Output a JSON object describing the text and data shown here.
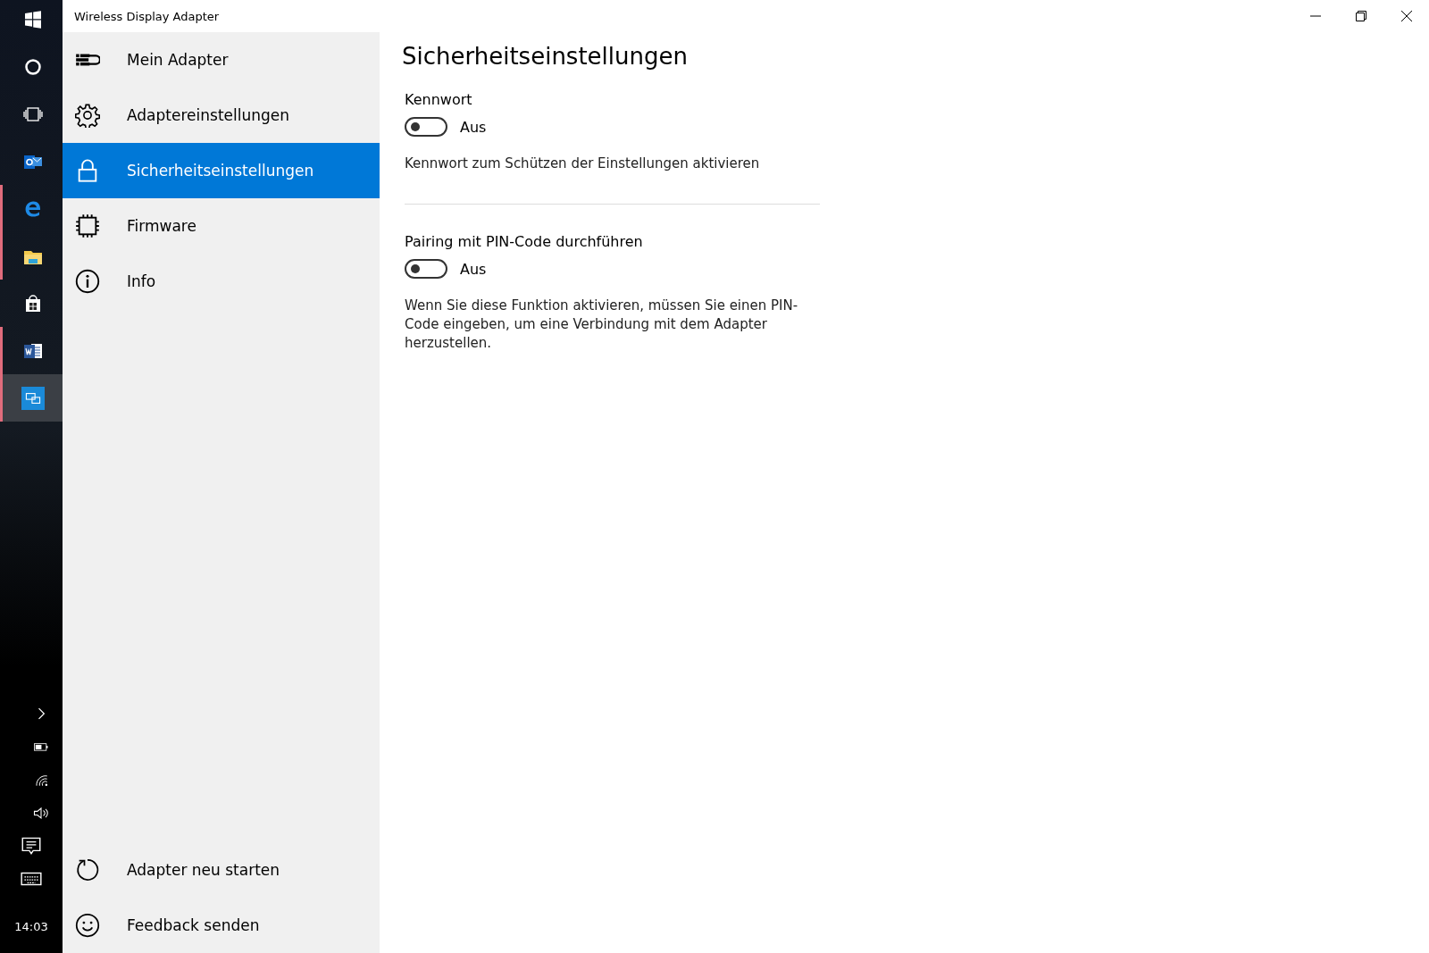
{
  "taskbar": {
    "apps": [
      {
        "kind": "start",
        "running": false,
        "selected": false
      },
      {
        "kind": "search",
        "running": false,
        "selected": false
      },
      {
        "kind": "taskview",
        "running": false,
        "selected": false
      },
      {
        "kind": "mail",
        "running": false,
        "selected": false
      },
      {
        "kind": "browser",
        "running": true,
        "selected": false
      },
      {
        "kind": "folder",
        "running": true,
        "selected": false
      },
      {
        "kind": "store",
        "running": false,
        "selected": false
      },
      {
        "kind": "word",
        "running": true,
        "selected": false
      },
      {
        "kind": "display",
        "running": true,
        "selected": true
      }
    ],
    "tray": [
      {
        "kind": "chevron"
      },
      {
        "kind": "battery"
      },
      {
        "kind": "wifi"
      },
      {
        "kind": "volume"
      },
      {
        "kind": "notifications"
      },
      {
        "kind": "keyboard"
      }
    ],
    "clock": "14:03"
  },
  "window": {
    "title": "Wireless Display Adapter"
  },
  "sidebar": {
    "items": [
      {
        "kind": "adapter",
        "label": "Mein Adapter",
        "selected": false
      },
      {
        "kind": "gear",
        "label": "Adaptereinstellungen",
        "selected": false
      },
      {
        "kind": "lock",
        "label": "Sicherheitseinstellungen",
        "selected": true
      },
      {
        "kind": "chip",
        "label": "Firmware",
        "selected": false
      },
      {
        "kind": "info",
        "label": "Info",
        "selected": false
      }
    ],
    "footer_items": [
      {
        "kind": "restart",
        "label": "Adapter neu starten"
      },
      {
        "kind": "smiley",
        "label": "Feedback senden"
      }
    ]
  },
  "page": {
    "title": "Sicherheitseinstellungen",
    "settings": [
      {
        "label": "Kennwort",
        "on": false,
        "state_text": "Aus",
        "description": "Kennwort zum Schützen der Einstellungen aktivieren"
      },
      {
        "label": "Pairing mit PIN-Code durchführen",
        "on": false,
        "state_text": "Aus",
        "description": "Wenn Sie diese Funktion aktivieren, müssen Sie einen PIN-Code eingeben, um eine Verbindung mit dem Adapter herzustellen."
      }
    ]
  }
}
